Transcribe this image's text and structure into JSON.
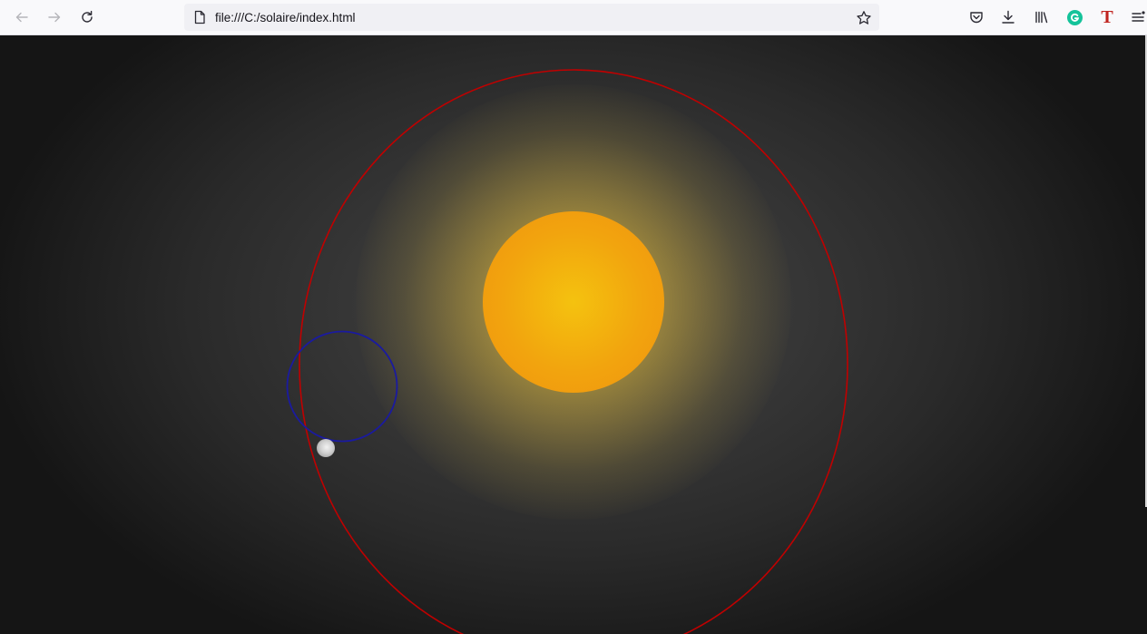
{
  "browser": {
    "url": "file:///C:/solaire/index.html",
    "toolbar_icons": {
      "back": "arrow-left-icon",
      "forward": "arrow-right-icon",
      "reload": "reload-icon",
      "page": "page-icon",
      "bookmark": "star-icon",
      "pocket": "pocket-icon",
      "downloads": "download-icon",
      "library": "library-icon",
      "grammarly": "grammarly-icon",
      "tfont": "font-t-icon",
      "menu": "hamburger-menu-icon"
    },
    "tfont_glyph": "T"
  },
  "scene": {
    "background_colors": [
      "#454545",
      "#151515"
    ],
    "sun_color": "#f2a40e",
    "sun_glow_color": "#f6d24a",
    "orbit_color": "#c00000",
    "moon_orbit_color": "#1a1aa0",
    "moon_color": "#cfcfcf"
  }
}
